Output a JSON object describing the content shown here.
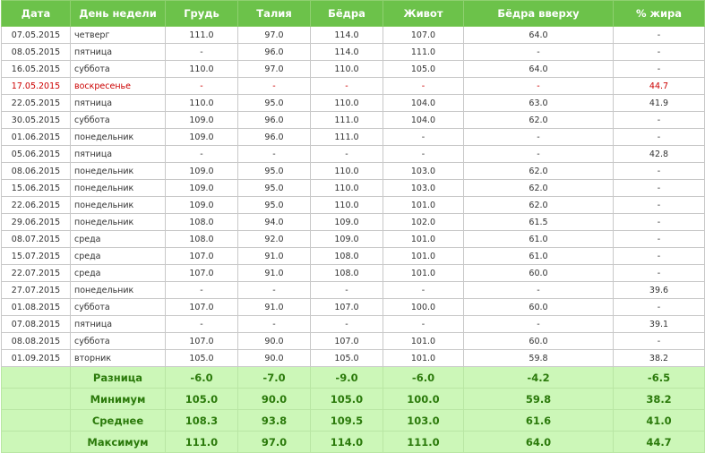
{
  "headers": [
    "Дата",
    "День недели",
    "Грудь",
    "Талия",
    "Бёдра",
    "Живот",
    "Бёдра вверху",
    "% жира"
  ],
  "rows": [
    {
      "date": "07.05.2015",
      "day": "четверг",
      "chest": "111.0",
      "waist": "97.0",
      "hips": "114.0",
      "belly": "107.0",
      "upper_hips": "64.0",
      "fat": "-"
    },
    {
      "date": "08.05.2015",
      "day": "пятница",
      "chest": "-",
      "waist": "96.0",
      "hips": "114.0",
      "belly": "111.0",
      "upper_hips": "-",
      "fat": "-"
    },
    {
      "date": "16.05.2015",
      "day": "суббота",
      "chest": "110.0",
      "waist": "97.0",
      "hips": "110.0",
      "belly": "105.0",
      "upper_hips": "64.0",
      "fat": "-"
    },
    {
      "date": "17.05.2015",
      "day": "воскресенье",
      "chest": "-",
      "waist": "-",
      "hips": "-",
      "belly": "-",
      "upper_hips": "-",
      "fat": "44.7",
      "highlight": true
    },
    {
      "date": "22.05.2015",
      "day": "пятница",
      "chest": "110.0",
      "waist": "95.0",
      "hips": "110.0",
      "belly": "104.0",
      "upper_hips": "63.0",
      "fat": "41.9"
    },
    {
      "date": "30.05.2015",
      "day": "суббота",
      "chest": "109.0",
      "waist": "96.0",
      "hips": "111.0",
      "belly": "104.0",
      "upper_hips": "62.0",
      "fat": "-"
    },
    {
      "date": "01.06.2015",
      "day": "понедельник",
      "chest": "109.0",
      "waist": "96.0",
      "hips": "111.0",
      "belly": "-",
      "upper_hips": "-",
      "fat": "-"
    },
    {
      "date": "05.06.2015",
      "day": "пятница",
      "chest": "-",
      "waist": "-",
      "hips": "-",
      "belly": "-",
      "upper_hips": "-",
      "fat": "42.8"
    },
    {
      "date": "08.06.2015",
      "day": "понедельник",
      "chest": "109.0",
      "waist": "95.0",
      "hips": "110.0",
      "belly": "103.0",
      "upper_hips": "62.0",
      "fat": "-"
    },
    {
      "date": "15.06.2015",
      "day": "понедельник",
      "chest": "109.0",
      "waist": "95.0",
      "hips": "110.0",
      "belly": "103.0",
      "upper_hips": "62.0",
      "fat": "-"
    },
    {
      "date": "22.06.2015",
      "day": "понедельник",
      "chest": "109.0",
      "waist": "95.0",
      "hips": "110.0",
      "belly": "101.0",
      "upper_hips": "62.0",
      "fat": "-"
    },
    {
      "date": "29.06.2015",
      "day": "понедельник",
      "chest": "108.0",
      "waist": "94.0",
      "hips": "109.0",
      "belly": "102.0",
      "upper_hips": "61.5",
      "fat": "-"
    },
    {
      "date": "08.07.2015",
      "day": "среда",
      "chest": "108.0",
      "waist": "92.0",
      "hips": "109.0",
      "belly": "101.0",
      "upper_hips": "61.0",
      "fat": "-"
    },
    {
      "date": "15.07.2015",
      "day": "среда",
      "chest": "107.0",
      "waist": "91.0",
      "hips": "108.0",
      "belly": "101.0",
      "upper_hips": "61.0",
      "fat": "-"
    },
    {
      "date": "22.07.2015",
      "day": "среда",
      "chest": "107.0",
      "waist": "91.0",
      "hips": "108.0",
      "belly": "101.0",
      "upper_hips": "60.0",
      "fat": "-"
    },
    {
      "date": "27.07.2015",
      "day": "понедельник",
      "chest": "-",
      "waist": "-",
      "hips": "-",
      "belly": "-",
      "upper_hips": "-",
      "fat": "39.6"
    },
    {
      "date": "01.08.2015",
      "day": "суббота",
      "chest": "107.0",
      "waist": "91.0",
      "hips": "107.0",
      "belly": "100.0",
      "upper_hips": "60.0",
      "fat": "-"
    },
    {
      "date": "07.08.2015",
      "day": "пятница",
      "chest": "-",
      "waist": "-",
      "hips": "-",
      "belly": "-",
      "upper_hips": "-",
      "fat": "39.1"
    },
    {
      "date": "08.08.2015",
      "day": "суббота",
      "chest": "107.0",
      "waist": "90.0",
      "hips": "107.0",
      "belly": "101.0",
      "upper_hips": "60.0",
      "fat": "-"
    },
    {
      "date": "01.09.2015",
      "day": "вторник",
      "chest": "105.0",
      "waist": "90.0",
      "hips": "105.0",
      "belly": "101.0",
      "upper_hips": "59.8",
      "fat": "38.2"
    }
  ],
  "stats": [
    {
      "label": "Разница",
      "chest": "-6.0",
      "waist": "-7.0",
      "hips": "-9.0",
      "belly": "-6.0",
      "upper_hips": "-4.2",
      "fat": "-6.5"
    },
    {
      "label": "Минимум",
      "chest": "105.0",
      "waist": "90.0",
      "hips": "105.0",
      "belly": "100.0",
      "upper_hips": "59.8",
      "fat": "38.2"
    },
    {
      "label": "Среднее",
      "chest": "108.3",
      "waist": "93.8",
      "hips": "109.5",
      "belly": "103.0",
      "upper_hips": "61.6",
      "fat": "41.0"
    },
    {
      "label": "Максимум",
      "chest": "111.0",
      "waist": "97.0",
      "hips": "114.0",
      "belly": "111.0",
      "upper_hips": "64.0",
      "fat": "44.7"
    }
  ],
  "colors": {
    "header_bg": "#6cc24a",
    "summary_bg": "#ccf7b8",
    "summary_text": "#2b7a0b",
    "weekend_text": "#cc0000"
  }
}
